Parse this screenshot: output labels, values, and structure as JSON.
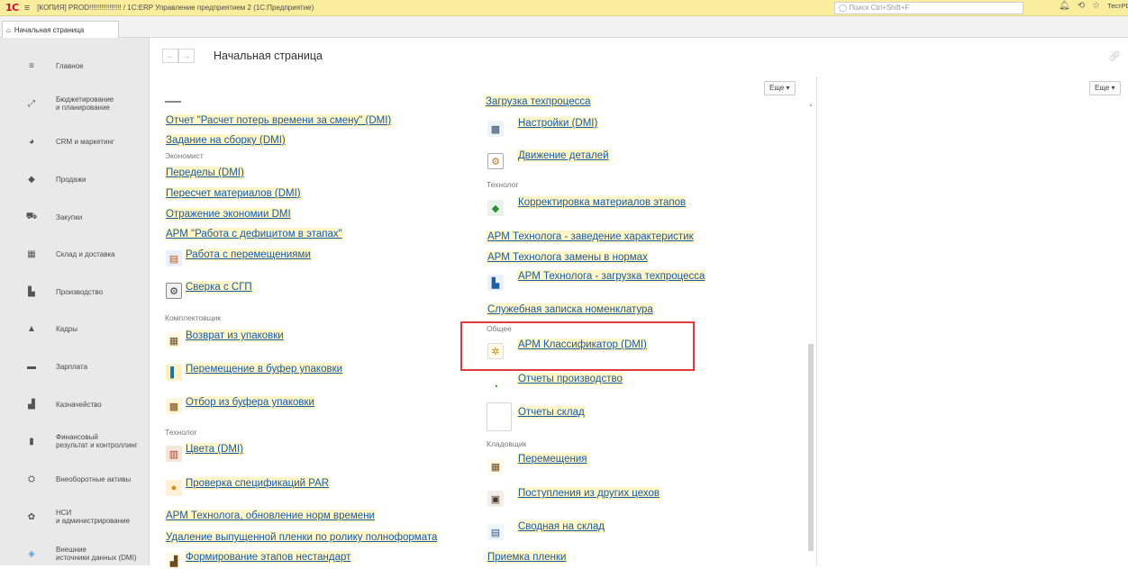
{
  "titlebar": {
    "logo": "1С",
    "menu_glyph": "≡",
    "title": "[КОПИЯ] PROD!!!!!!!!!!!!!!!! / 1С:ERP Управление предприятием 2  (1С:Предприятие)",
    "search_placeholder": "Поиск Ctrl+Shift+F",
    "user": "ТестPDM"
  },
  "tabs": [
    {
      "label": "Начальная страница"
    }
  ],
  "sidebar": {
    "items": [
      {
        "label": "Главное",
        "icon": "menu-lines-icon"
      },
      {
        "label": "Бюджетирование\nи планирование",
        "icon": "chart-icon"
      },
      {
        "label": "CRM и маркетинг",
        "icon": "pie-icon"
      },
      {
        "label": "Продажи",
        "icon": "bag-icon"
      },
      {
        "label": "Закупки",
        "icon": "cart-icon"
      },
      {
        "label": "Склад и доставка",
        "icon": "warehouse-icon"
      },
      {
        "label": "Производство",
        "icon": "factory-icon"
      },
      {
        "label": "Кадры",
        "icon": "person-icon"
      },
      {
        "label": "Зарплата",
        "icon": "money-icon"
      },
      {
        "label": "Казначейство",
        "icon": "treasury-icon"
      },
      {
        "label": "Финансовый\nрезультат и контроллинг",
        "icon": "bars-icon"
      },
      {
        "label": "Внеоборотные активы",
        "icon": "assets-icon"
      },
      {
        "label": "НСИ\nи администрирование",
        "icon": "gear-icon"
      },
      {
        "label": "Внешние\nисточники данных (DMI)",
        "icon": "data-source-icon"
      }
    ]
  },
  "header": {
    "back": "←",
    "forward": "→",
    "title": "Начальная страница",
    "more_label": "Еще ▾"
  },
  "left_column": {
    "items": [
      {
        "type": "link",
        "text": "Отчет \"Расчет потерь времени за смену\" (DMI)"
      },
      {
        "type": "link",
        "text": "Задание на сборку (DMI)"
      },
      {
        "type": "group",
        "text": "Экономист"
      },
      {
        "type": "link",
        "text": "Переделы (DMI)"
      },
      {
        "type": "link",
        "text": "Пересчет материалов (DMI)"
      },
      {
        "type": "link",
        "text": "Отражение экономии DMI"
      },
      {
        "type": "link",
        "text": "АРМ \"Работа с дефицитом в этапах\""
      },
      {
        "type": "icon-link",
        "text": "Работа с перемещениями"
      },
      {
        "type": "icon-link",
        "text": "Сверка с СГП"
      },
      {
        "type": "group",
        "text": "Комплектовщик"
      },
      {
        "type": "icon-link",
        "text": "Возврат из упаковки"
      },
      {
        "type": "icon-link",
        "text": "Перемещение в буфер упаковки"
      },
      {
        "type": "icon-link",
        "text": "Отбор из буфера упаковки"
      },
      {
        "type": "group",
        "text": "Технолог"
      },
      {
        "type": "icon-link",
        "text": "Цвета (DMI)"
      },
      {
        "type": "icon-link",
        "text": "Проверка спецификаций PAR"
      },
      {
        "type": "link",
        "text": "АРМ Технолога, обновление норм времени"
      },
      {
        "type": "link",
        "text": "Удаление выпущенной пленки по ролику полноформата"
      },
      {
        "type": "icon-link",
        "text": "Формирование этапов нестандарт"
      }
    ]
  },
  "right_column": {
    "items": [
      {
        "type": "link",
        "text": "Загрузка техпроцесса"
      },
      {
        "type": "icon-link",
        "text": "Настройки (DMI)"
      },
      {
        "type": "icon-link",
        "text": "Движение деталей"
      },
      {
        "type": "group",
        "text": "Технолог"
      },
      {
        "type": "icon-link",
        "text": "Корректировка материалов этапов"
      },
      {
        "type": "link",
        "text": "АРМ Технолога - заведение характеристик"
      },
      {
        "type": "link",
        "text": "АРМ Технолога замены в нормах"
      },
      {
        "type": "icon-link",
        "text": "АРМ Технолога - загрузка техпроцесса"
      },
      {
        "type": "link",
        "text": "Служебная записка номенклатура"
      },
      {
        "type": "group",
        "text": "Общее"
      },
      {
        "type": "icon-link",
        "text": "АРМ Классификатор (DMI)"
      },
      {
        "type": "icon-link",
        "text": "Отчеты производство"
      },
      {
        "type": "icon-link",
        "text": "Отчеты склад"
      },
      {
        "type": "group",
        "text": "Кладовщик"
      },
      {
        "type": "icon-link",
        "text": "Перемещения"
      },
      {
        "type": "icon-link",
        "text": "Поступления из других цехов"
      },
      {
        "type": "icon-link",
        "text": "Сводная на склад"
      },
      {
        "type": "link",
        "text": "Приемка пленки"
      }
    ]
  }
}
